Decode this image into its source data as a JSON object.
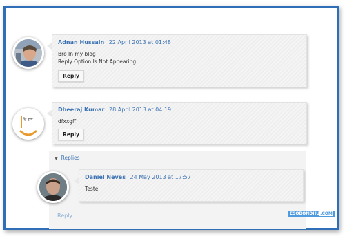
{
  "comments": [
    {
      "author": "Adnan Hussain",
      "date": "22 April 2013 at 01:48",
      "lines": [
        "Bro In my blog",
        "Reply Option Is Not Appearing"
      ],
      "reply_label": "Reply"
    },
    {
      "author": "Dheeraj Kumar",
      "date": "28 April 2013 at 04:19",
      "lines": [
        "dfxxgff"
      ],
      "reply_label": "Reply",
      "avatar_text": "धि राग"
    }
  ],
  "replies": {
    "toggle_label": "Replies",
    "items": [
      {
        "author": "Daniel Neves",
        "date": "24 May 2013 at 17:57",
        "lines": [
          "Teste"
        ]
      }
    ],
    "reply_link": "Reply"
  },
  "watermark": {
    "main": "ESOBONDHU",
    "suffix": ".COM"
  },
  "colors": {
    "frame_border": "#2f6fb8",
    "link": "#3d73b3",
    "watermark_bg": "#4f9be0"
  }
}
